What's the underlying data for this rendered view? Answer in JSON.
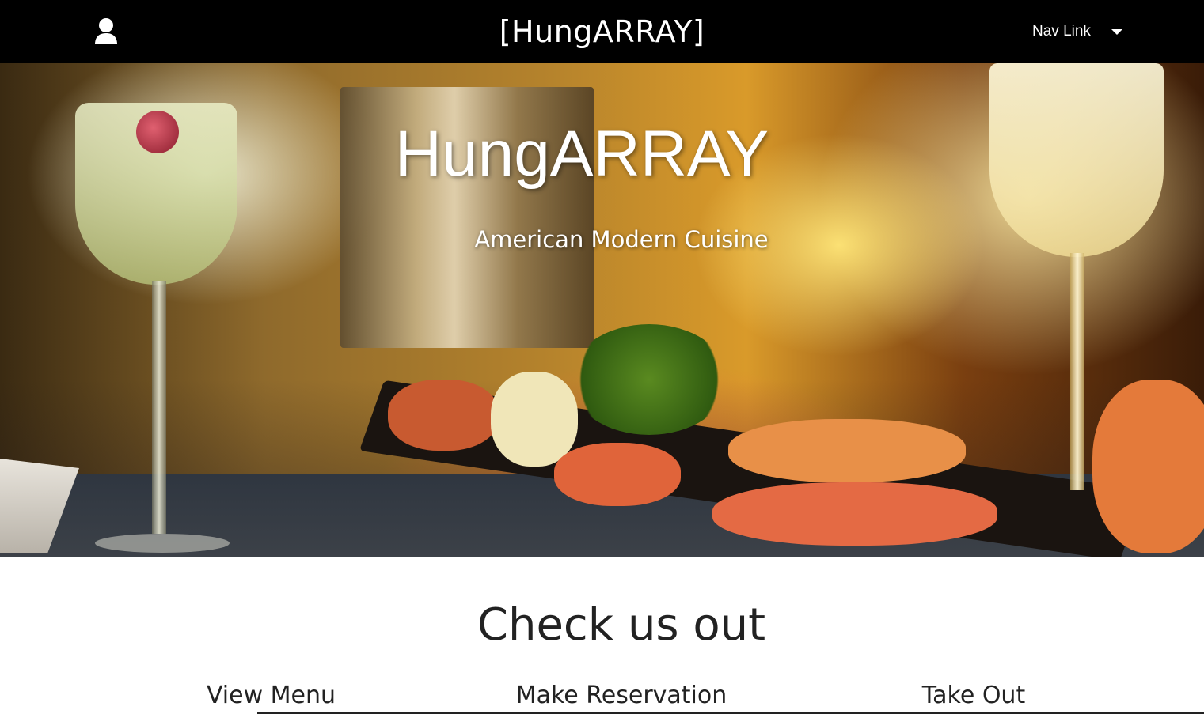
{
  "navbar": {
    "user_icon": "user-icon",
    "brand": "[HungARRAY]",
    "nav_link": "Nav Link",
    "dropdown_icon": "caret-down-icon"
  },
  "hero": {
    "title": "HungARRAY",
    "subtitle": "American Modern Cuisine"
  },
  "section": {
    "title": "Check us out",
    "links": [
      "View Menu",
      "Make Reservation",
      "Take Out"
    ]
  },
  "colors": {
    "navbar_bg": "#000000",
    "text_dark": "#222222",
    "text_light": "#ffffff"
  }
}
